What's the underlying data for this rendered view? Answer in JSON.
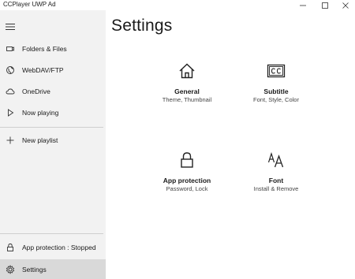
{
  "window": {
    "title": "CCPlayer UWP Ad"
  },
  "sidebar": {
    "items": [
      {
        "label": "Folders & Files",
        "icon": "folder-icon"
      },
      {
        "label": "WebDAV/FTP",
        "icon": "globe-icon"
      },
      {
        "label": "OneDrive",
        "icon": "cloud-icon"
      },
      {
        "label": "Now playing",
        "icon": "play-icon"
      },
      {
        "label": "New playlist",
        "icon": "plus-icon"
      }
    ],
    "footer": [
      {
        "label": "App protection : Stopped",
        "icon": "lock-icon"
      },
      {
        "label": "Settings",
        "icon": "gear-icon",
        "selected": true
      }
    ]
  },
  "main": {
    "title": "Settings",
    "tiles": [
      {
        "title": "General",
        "subtitle": "Theme, Thumbnail",
        "icon": "home-icon"
      },
      {
        "title": "Subtitle",
        "subtitle": "Font, Style, Color",
        "icon": "closed-caption-icon"
      },
      {
        "title": "App protection",
        "subtitle": "Password, Lock",
        "icon": "lock-icon"
      },
      {
        "title": "Font",
        "subtitle": "Install & Remove",
        "icon": "font-icon"
      }
    ]
  },
  "colors": {
    "sidebar_bg": "#f2f2f2",
    "selected_bg": "#d9d9d9",
    "text": "#1a1a1a",
    "subtext": "#444444"
  }
}
